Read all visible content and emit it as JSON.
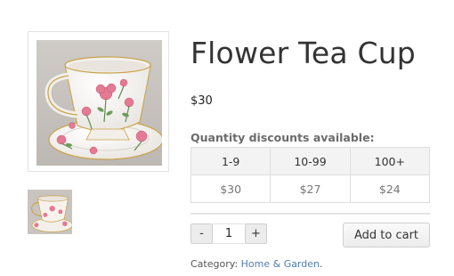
{
  "product": {
    "title": "Flower Tea Cup",
    "price": "$30",
    "image_icon": "floral-teacup-image",
    "thumbnail_icon": "floral-teacup-thumbnail"
  },
  "discounts": {
    "heading": "Quantity discounts available:",
    "tiers": [
      {
        "range": "1-9",
        "price": "$30"
      },
      {
        "range": "10-99",
        "price": "$27"
      },
      {
        "range": "100+",
        "price": "$24"
      }
    ]
  },
  "cart": {
    "minus_label": "-",
    "quantity": "1",
    "plus_label": "+",
    "add_label": "Add to cart"
  },
  "meta": {
    "category_label": "Category:",
    "category_value": "Home & Garden",
    "category_suffix": "."
  },
  "colors": {
    "link": "#4f7fb0",
    "border": "#dedede",
    "header_bg": "#f3f3f3"
  }
}
